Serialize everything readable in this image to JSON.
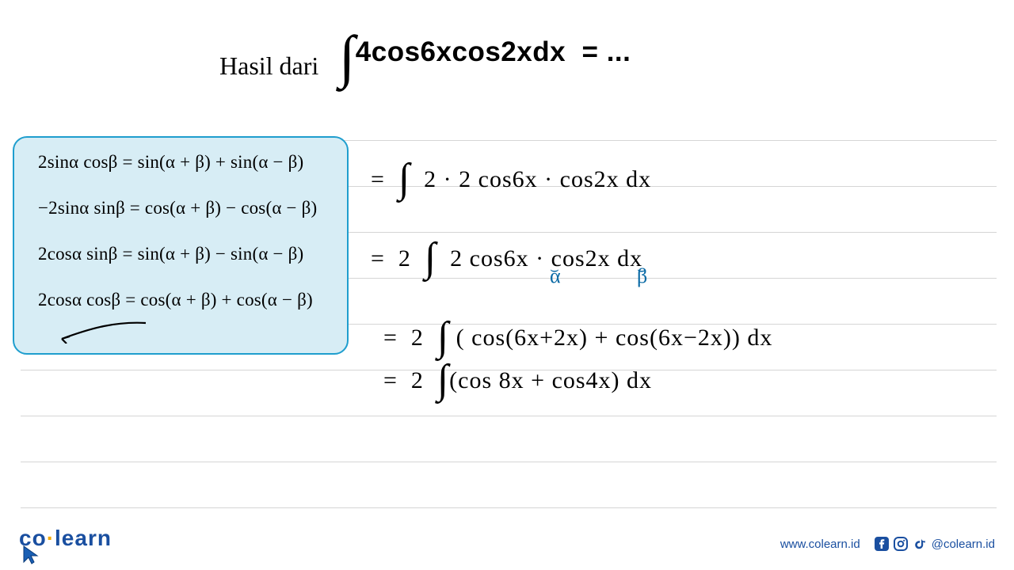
{
  "title_prefix": "Hasil dari",
  "integral_label": "4cos6xcos2xdx",
  "equals_dots": "= ...",
  "identities": {
    "row1": "2sinα cosβ = sin(α + β) + sin(α − β)",
    "row2": "−2sinα sinβ = cos(α + β) − cos(α − β)",
    "row3": "2cosα sinβ = sin(α + β) − sin(α − β)",
    "row4": "2cosα cosβ = cos(α + β) + cos(α − β)"
  },
  "work": {
    "line1": "=  ∫  2 · 2 cos6x · cos2x dx",
    "line2": "=  2  ∫  2 cos6x · cos2x dx",
    "line2_alpha": "α",
    "line2_beta": "β",
    "line3": "=  2  ∫ ( cos(6x+2x) + cos(6x−2x)) dx",
    "line4": "=  2  ∫(cos 8x + cos4x) dx"
  },
  "footer": {
    "logo_left": "co",
    "logo_right": "learn",
    "url": "www.colearn.id",
    "handle": "@colearn.id"
  },
  "icons": {
    "facebook": "facebook-icon",
    "instagram": "instagram-icon",
    "tiktok": "tiktok-icon",
    "cursor": "cursor-icon"
  }
}
